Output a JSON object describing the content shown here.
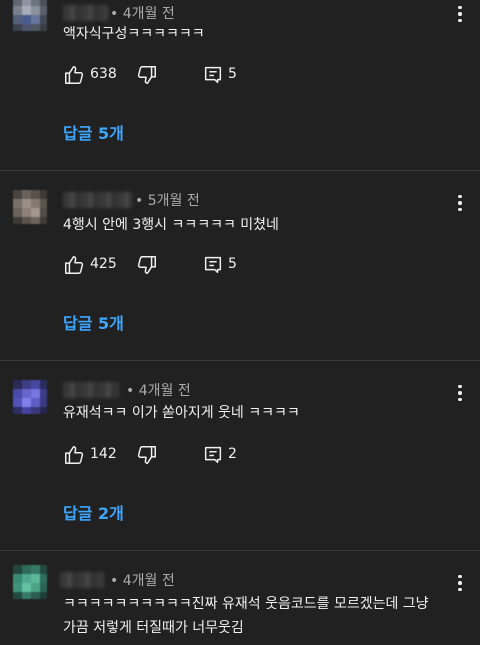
{
  "comments": [
    {
      "time": "4개월 전",
      "text_lines": [
        "액자식구성ㅋㅋㅋㅋㅋㅋ"
      ],
      "likes": "638",
      "reply_count": "5",
      "replies_label": "답글 5개"
    },
    {
      "time": "5개월 전",
      "text_lines": [
        "4행시 안에 3행시 ㅋㅋㅋㅋㅋ 미쳤네"
      ],
      "likes": "425",
      "reply_count": "5",
      "replies_label": "답글 5개"
    },
    {
      "time": "4개월 전",
      "text_lines": [
        "유재석ㅋㅋ 이가 쏟아지게 웃네 ㅋㅋㅋㅋ"
      ],
      "likes": "142",
      "reply_count": "2",
      "replies_label": "답글 2개"
    },
    {
      "time": "4개월 전",
      "text_lines": [
        "ㅋㅋㅋㅋㅋㅋㅋㅋㅋㅋ진짜 유재석 웃음코드를 모르겠는데 그냥",
        "가끔 저렇게 터질때가 너무웃김"
      ]
    }
  ],
  "separator": "•",
  "colors": {
    "background": "#212121",
    "text": "#f1f1f1",
    "meta": "#aaaaaa",
    "reply_link": "#3ea6ff",
    "divider": "#3a3a3a"
  },
  "icons": {
    "like": "thumb-up-icon",
    "dislike": "thumb-down-icon",
    "reply": "comment-icon",
    "more": "more-vert-icon"
  }
}
